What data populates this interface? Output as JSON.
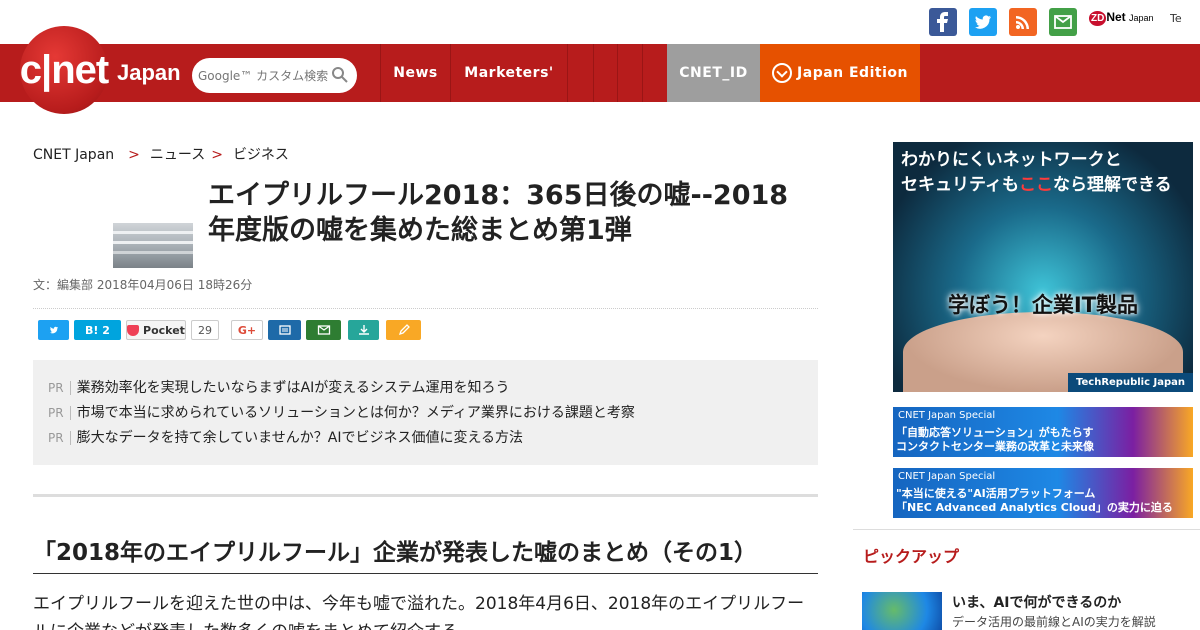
{
  "colors": {
    "brand_red": "#b71c1c",
    "nav_gray": "#9e9e9e",
    "nav_orange": "#e65100"
  },
  "topbar": {
    "social": [
      "facebook-icon",
      "twitter-icon",
      "rss-icon",
      "mail-icon"
    ],
    "zdnet": {
      "mark": "ZD",
      "name": "Net",
      "region": "Japan"
    },
    "tech_partial": "Te"
  },
  "header": {
    "logo": "c|net",
    "logo_region": "Japan",
    "search_placeholder": "Google™ カスタム検索",
    "nav": [
      "News",
      "Marketers'"
    ],
    "cnet_id": "CNET_ID",
    "edition": "Japan Edition"
  },
  "breadcrumb": {
    "home": "CNET Japan",
    "sep": ">",
    "level1": "ニュース",
    "level2": "ビジネス"
  },
  "article": {
    "title": "エイプリルフール2018：365日後の嘘--2018年度版の嘘を集めた総まとめ第1弾",
    "date": "文：編集部 2018年04月06日 18時26分",
    "share": {
      "hatena": "B! 2",
      "pocket": "Pocket",
      "pocket_count": "29",
      "gplus": "G+"
    },
    "pr_tag": "PR",
    "pr_items": [
      "業務効率化を実現したいならまずはAIが変えるシステム運用を知ろう",
      "市場で本当に求められているソリューションとは何か？メディア業界における課題と考察",
      "膨大なデータを持て余していませんか？AIでビジネス価値に変える方法"
    ],
    "heading": "「2018年のエイプリルフール」企業が発表した嘘のまとめ（その1）",
    "body": "エイプリルフールを迎えた世の中は、今年も嘘で溢れた。2018年4月6日、2018年のエイプリルフールに企業などが発表した数多くの嘘をまとめて紹介する。"
  },
  "sidebar": {
    "ad_main": {
      "line1": "わかりにくいネットワークと",
      "line2_pre": "セキュリティも",
      "line2_em": "ここ",
      "line2_post": "なら理解できる",
      "center": "学ぼう！企業IT製品",
      "footer": "TechRepublic Japan"
    },
    "specials": [
      {
        "label": "CNET Japan Special",
        "line1": "「自動応答ソリューション」がもたらす",
        "line2": "コンタクトセンター業務の改革と未来像"
      },
      {
        "label": "CNET Japan Special",
        "line1": "\"本当に使える\"AI活用プラットフォーム",
        "line2": "「NEC Advanced Analytics Cloud」の実力に迫る"
      }
    ],
    "pickup_heading": "ピックアップ",
    "pickup": {
      "title": "いま、AIで何ができるのか",
      "sub": "データ活用の最前線とAIの実力を解説"
    }
  }
}
